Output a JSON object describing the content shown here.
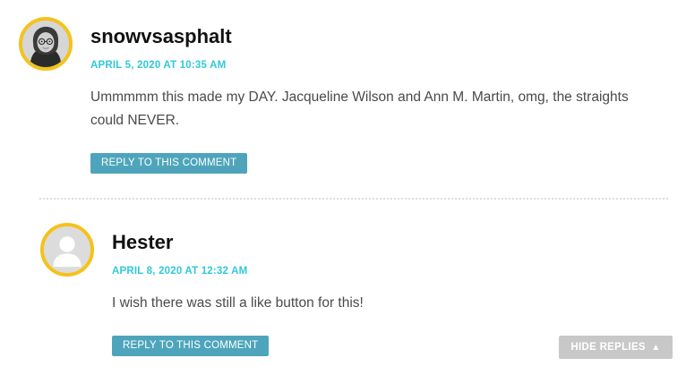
{
  "comments": [
    {
      "author": "snowvsasphalt",
      "timestamp": "APRIL 5, 2020 AT 10:35 AM",
      "body_line1": "Ummmmm this made my DAY. Jacqueline Wilson and Ann M. Martin, omg, the straights",
      "body_line2": "could NEVER.",
      "reply_label": "REPLY TO THIS COMMENT",
      "avatar": "user-photo-avatar"
    },
    {
      "author": "Hester",
      "timestamp": "APRIL 8, 2020 AT 12:32 AM",
      "body_line1": "I wish there was still a like button for this!",
      "reply_label": "REPLY TO THIS COMMENT",
      "avatar": "default-user-avatar"
    }
  ],
  "hide_replies": {
    "label": "HIDE REPLIES",
    "icon": "triangle-up-icon"
  },
  "colors": {
    "avatar_ring": "#f4c21a",
    "timestamp": "#2fc9d8",
    "reply_button": "#4ea5bb",
    "hide_replies_button": "#c8c8c8"
  }
}
